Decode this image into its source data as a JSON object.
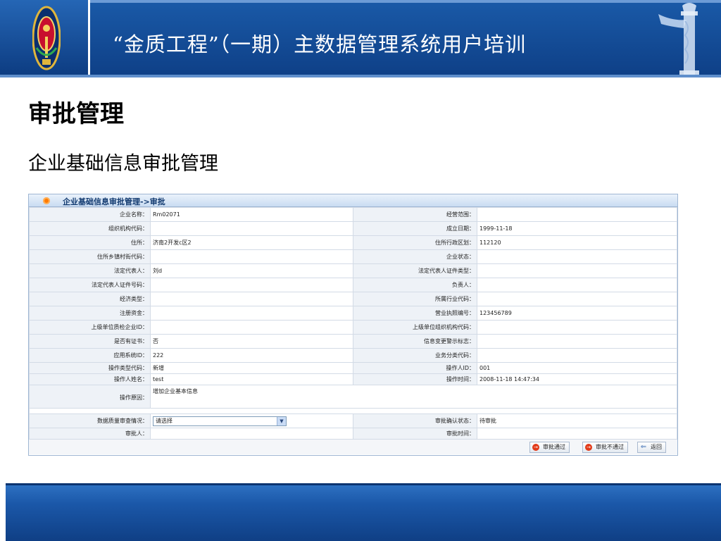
{
  "slide": {
    "title": "“金质工程”（一期）主数据管理系统用户培训",
    "section_title": "审批管理",
    "subtitle": "企业基础信息审批管理"
  },
  "panel": {
    "title": "企业基础信息审批管理->审批",
    "rows": [
      {
        "l1": "企业名称：",
        "v1": "Rm02071",
        "l2": "经营范围：",
        "v2": ""
      },
      {
        "l1": "组织机构代码：",
        "v1": "",
        "l2": "成立日期：",
        "v2": "1999-11-18"
      },
      {
        "l1": "住所：",
        "v1": "济南2开发c区2",
        "l2": "住所行政区划：",
        "v2": "112120"
      },
      {
        "l1": "住所乡镇村街代码：",
        "v1": "",
        "l2": "企业状态：",
        "v2": ""
      },
      {
        "l1": "法定代表人：",
        "v1": "刘d",
        "l2": "法定代表人证件类型：",
        "v2": ""
      },
      {
        "l1": "法定代表人证件号码：",
        "v1": "",
        "l2": "负责人：",
        "v2": ""
      },
      {
        "l1": "经济类型：",
        "v1": "",
        "l2": "所属行业代码：",
        "v2": ""
      },
      {
        "l1": "注册资金：",
        "v1": "",
        "l2": "营业执照编号：",
        "v2": "123456789"
      },
      {
        "l1": "上级单位质检企业ID：",
        "v1": "",
        "l2": "上级单位组织机构代码：",
        "v2": ""
      },
      {
        "l1": "是否有证书：",
        "v1": "否",
        "l2": "信息变更警示标志：",
        "v2": ""
      },
      {
        "l1": "应用系统ID：",
        "v1": "222",
        "l2": "业务分类代码：",
        "v2": ""
      }
    ],
    "short_rows": [
      {
        "l1": "操作类型代码：",
        "v1": "新增",
        "l2": "操作人ID：",
        "v2": "001"
      },
      {
        "l1": "操作人姓名：",
        "v1": "test",
        "l2": "操作时间：",
        "v2": "2008-11-18 14:47:34"
      }
    ],
    "reason": {
      "label": "操作原因：",
      "value": "增加企业基本信息"
    },
    "quality": {
      "label": "数据质量审查情况：",
      "select_value": "请选择",
      "l2": "审批确认状态：",
      "v2": "待审批"
    },
    "approver": {
      "label": "审批人：",
      "value": "",
      "l2": "审批时间：",
      "v2": ""
    },
    "buttons": {
      "approve": "审批通过",
      "reject": "审批不通过",
      "back": "返回"
    }
  }
}
